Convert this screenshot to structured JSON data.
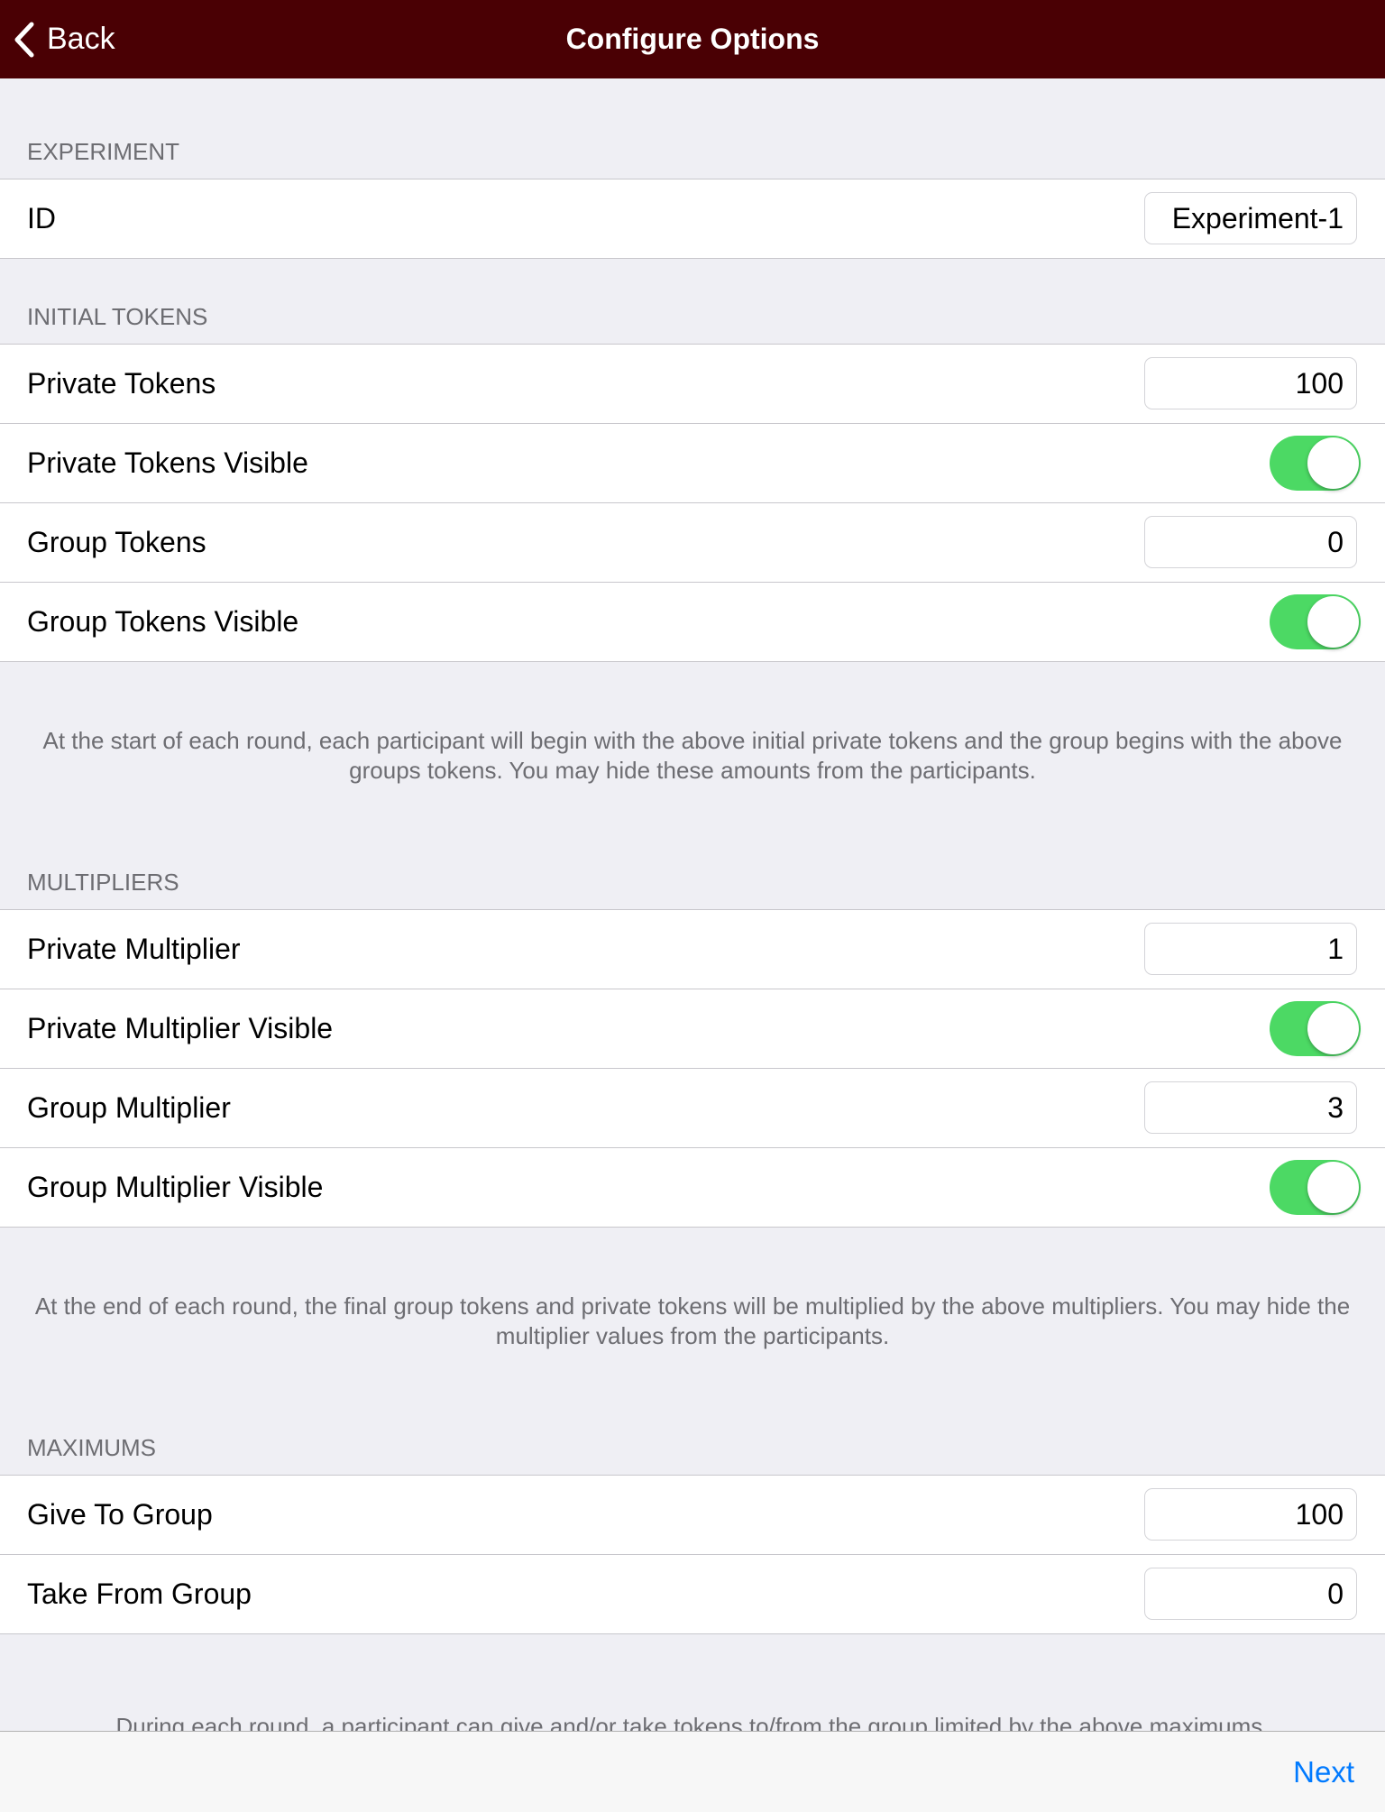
{
  "nav": {
    "back_label": "Back",
    "title": "Configure Options",
    "background": "#4a0004"
  },
  "sections": {
    "experiment": {
      "header": "EXPERIMENT",
      "rows": [
        {
          "label": "ID",
          "value": "Experiment-1"
        }
      ]
    },
    "initial_tokens": {
      "header": "INITIAL TOKENS",
      "rows": [
        {
          "label": "Private Tokens",
          "value": "100"
        },
        {
          "label": "Private Tokens Visible",
          "on": true
        },
        {
          "label": "Group Tokens",
          "value": "0"
        },
        {
          "label": "Group Tokens Visible",
          "on": true
        }
      ],
      "footer": "At the start of each round, each participant will begin with the above initial private tokens and the group begins with the above groups tokens. You may hide these amounts from the participants."
    },
    "multipliers": {
      "header": "MULTIPLIERS",
      "rows": [
        {
          "label": "Private Multiplier",
          "value": "1"
        },
        {
          "label": "Private Multiplier Visible",
          "on": true
        },
        {
          "label": "Group Multiplier",
          "value": "3"
        },
        {
          "label": "Group Multiplier Visible",
          "on": true
        }
      ],
      "footer": "At the end of each round, the final group tokens and private tokens will be multiplied by the above multipliers. You may hide the multiplier values from the participants."
    },
    "maximums": {
      "header": "MAXIMUMS",
      "rows": [
        {
          "label": "Give To Group",
          "value": "100"
        },
        {
          "label": "Take From Group",
          "value": "0"
        }
      ],
      "footer": "During each round, a participant can give and/or take tokens to/from the group limited by the above maximums."
    }
  },
  "toolbar": {
    "next_label": "Next",
    "accent": "#007aff"
  },
  "toggle_color": "#4cd964"
}
